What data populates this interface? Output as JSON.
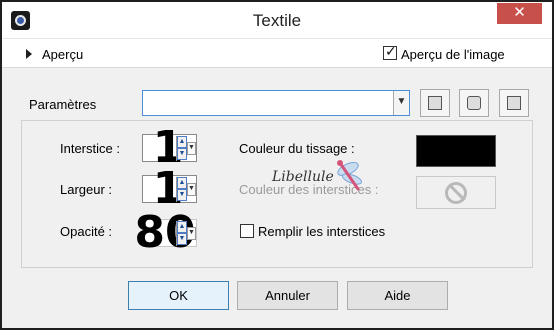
{
  "window": {
    "title": "Textile",
    "close_symbol": "✕"
  },
  "preview": {
    "label": "Aperçu",
    "show_preview_label": "Aperçu de l'image",
    "show_preview_checked": true
  },
  "presets": {
    "label": "Paramètres",
    "value": ""
  },
  "fields": {
    "gap": {
      "label": "Interstice :",
      "value": "1"
    },
    "width": {
      "label": "Largeur :",
      "value": "1"
    },
    "opacity": {
      "label": "Opacité :",
      "value": "80"
    }
  },
  "colors": {
    "weave": {
      "label": "Couleur du tissage :",
      "color": "#000000"
    },
    "gaps": {
      "label": "Couleur des interstices :",
      "enabled": false
    }
  },
  "fill_gaps": {
    "label": "Remplir les interstices",
    "checked": false
  },
  "watermark": {
    "text": "Libellule"
  },
  "buttons": {
    "ok": "OK",
    "cancel": "Annuler",
    "help": "Aide"
  },
  "theme": {
    "close_red": "#c7504a",
    "focus_blue": "#4a90d9"
  }
}
